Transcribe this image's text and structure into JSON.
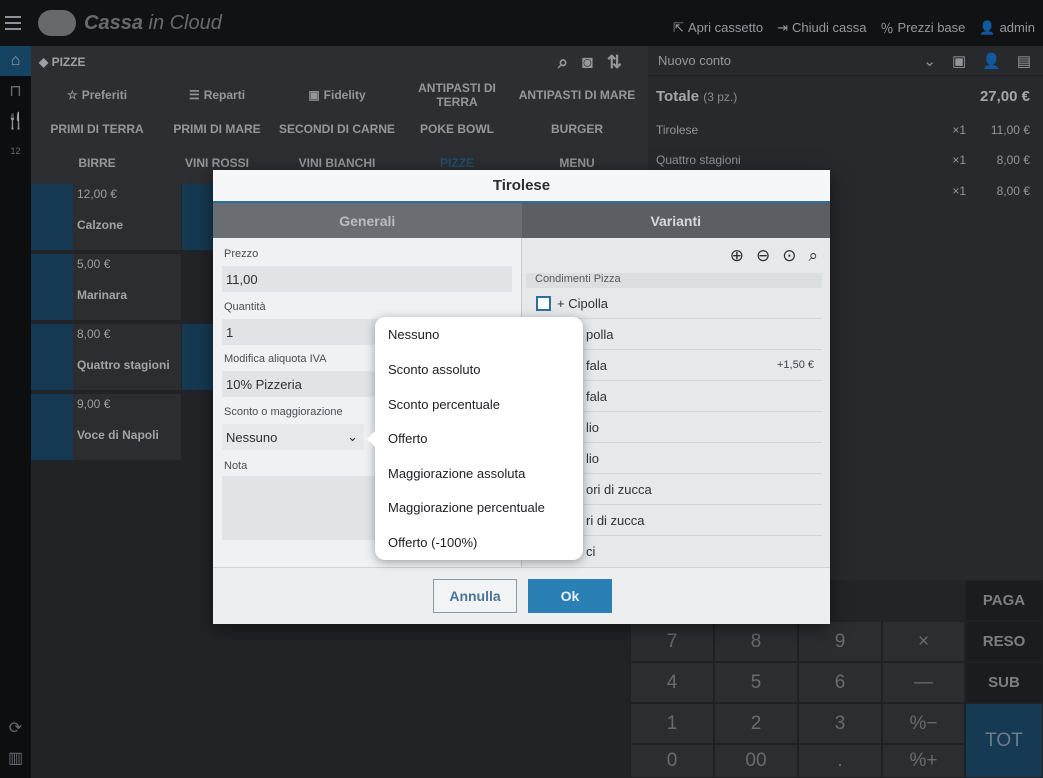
{
  "app": {
    "logo_bold": "Cassa",
    "logo_rest": " in Cloud"
  },
  "topbar": {
    "links": [
      "Apri cassetto",
      "Chiudi cassa",
      "Prezzi base",
      "admin"
    ]
  },
  "sidebar": {
    "badge": "12"
  },
  "category": {
    "current": "PIZZE",
    "items": [
      "Preferiti",
      "Reparti",
      "Fidelity",
      "ANTIPASTI DI TERRA",
      "ANTIPASTI DI MARE",
      "PRIMI DI TERRA",
      "PRIMI DI MARE",
      "SECONDI DI CARNE",
      "POKE BOWL",
      "BURGER",
      "BIRRE",
      "VINI ROSSI",
      "VINI BIANCHI",
      "PIZZE",
      "MENU"
    ]
  },
  "products": [
    {
      "price": "12,00 €",
      "name": "Calzone"
    },
    {
      "price": "5,00 €",
      "name": "Marinara"
    },
    {
      "price": "8,00 €",
      "name": "Quattro stagioni"
    },
    {
      "price": "9,00 €",
      "name": "Voce di Napoli"
    }
  ],
  "cart": {
    "account": "Nuovo conto",
    "total_label": "Totale",
    "total_pieces": "(3 pz.)",
    "total_value": "27,00 €",
    "lines": [
      {
        "name": "Tirolese",
        "qty": "×1",
        "price": "11,00 €"
      },
      {
        "name": "Quattro stagioni",
        "qty": "×1",
        "price": "8,00 €"
      },
      {
        "name": "",
        "qty": "×1",
        "price": "8,00 €"
      }
    ]
  },
  "keypad": {
    "digits": [
      "7",
      "8",
      "9",
      "4",
      "5",
      "6",
      "1",
      "2",
      "3",
      "0",
      "00",
      "."
    ],
    "ops": [
      "×",
      "—",
      "%−",
      "%+"
    ],
    "actions": [
      "PAGA",
      "RESO",
      "SUB",
      "TOT"
    ]
  },
  "modal": {
    "title": "Tirolese",
    "tabs": [
      "Generali",
      "Varianti"
    ],
    "prezzo_label": "Prezzo",
    "prezzo": "11,00",
    "quantita_label": "Quantità",
    "quantita": "1",
    "iva_label": "Modifica aliquota IVA",
    "iva": "10% Pizzeria",
    "sconto_label": "Sconto o maggiorazione",
    "sconto": "Nessuno",
    "nota_label": "Nota",
    "group": "Condimenti Pizza",
    "variants": [
      {
        "name": "+ Cipolla",
        "price": ""
      },
      {
        "name": "polla",
        "price": ""
      },
      {
        "name": "fala",
        "price": "+1,50 €"
      },
      {
        "name": "fala",
        "price": ""
      },
      {
        "name": "lio",
        "price": ""
      },
      {
        "name": "lio",
        "price": ""
      },
      {
        "name": "ori di zucca",
        "price": ""
      },
      {
        "name": "ri di zucca",
        "price": ""
      },
      {
        "name": "ci",
        "price": ""
      }
    ],
    "cancel": "Annulla",
    "ok": "Ok"
  },
  "dropdown": {
    "options": [
      "Nessuno",
      "Sconto assoluto",
      "Sconto percentuale",
      "Offerto",
      "Maggiorazione assoluta",
      "Maggiorazione percentuale",
      "Offerto (-100%)"
    ]
  }
}
